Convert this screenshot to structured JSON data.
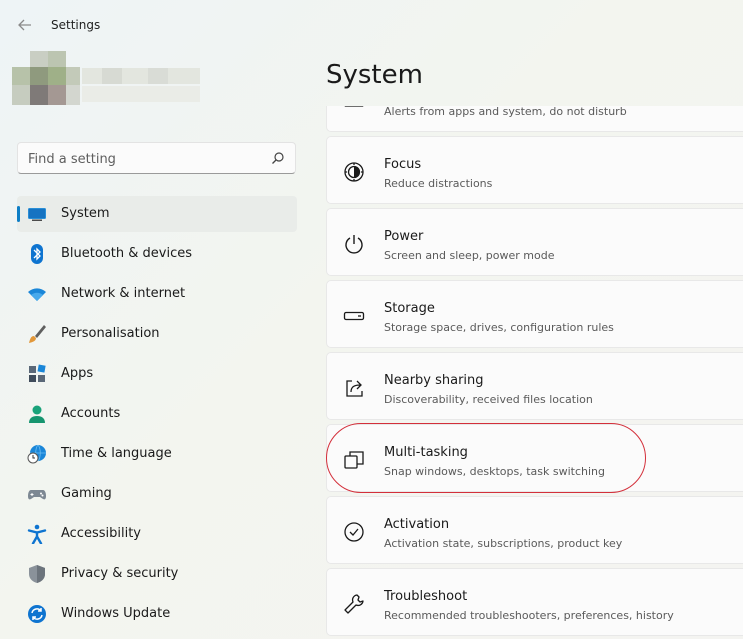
{
  "window": {
    "title": "Settings"
  },
  "search": {
    "placeholder": "Find a setting"
  },
  "nav": {
    "items": [
      {
        "label": "System",
        "icon": "monitor-icon",
        "active": true
      },
      {
        "label": "Bluetooth & devices",
        "icon": "bluetooth-icon"
      },
      {
        "label": "Network & internet",
        "icon": "wifi-icon"
      },
      {
        "label": "Personalisation",
        "icon": "brush-icon"
      },
      {
        "label": "Apps",
        "icon": "apps-icon"
      },
      {
        "label": "Accounts",
        "icon": "person-icon"
      },
      {
        "label": "Time & language",
        "icon": "globe-clock-icon"
      },
      {
        "label": "Gaming",
        "icon": "gamepad-icon"
      },
      {
        "label": "Accessibility",
        "icon": "accessibility-icon"
      },
      {
        "label": "Privacy & security",
        "icon": "shield-icon"
      },
      {
        "label": "Windows Update",
        "icon": "sync-icon"
      }
    ]
  },
  "page": {
    "title": "System"
  },
  "cards": [
    {
      "title": "",
      "subtitle": "Alerts from apps and system, do not disturb",
      "icon": "bell-icon"
    },
    {
      "title": "Focus",
      "subtitle": "Reduce distractions",
      "icon": "focus-icon"
    },
    {
      "title": "Power",
      "subtitle": "Screen and sleep, power mode",
      "icon": "power-icon"
    },
    {
      "title": "Storage",
      "subtitle": "Storage space, drives, configuration rules",
      "icon": "drive-icon"
    },
    {
      "title": "Nearby sharing",
      "subtitle": "Discoverability, received files location",
      "icon": "share-icon"
    },
    {
      "title": "Multi-tasking",
      "subtitle": "Snap windows, desktops, task switching",
      "icon": "multitask-icon"
    },
    {
      "title": "Activation",
      "subtitle": "Activation state, subscriptions, product key",
      "icon": "check-circle-icon"
    },
    {
      "title": "Troubleshoot",
      "subtitle": "Recommended troubleshooters, preferences, history",
      "icon": "wrench-icon"
    }
  ],
  "colors": {
    "accent": "#0e7ec6",
    "highlight": "#d32f3a"
  }
}
